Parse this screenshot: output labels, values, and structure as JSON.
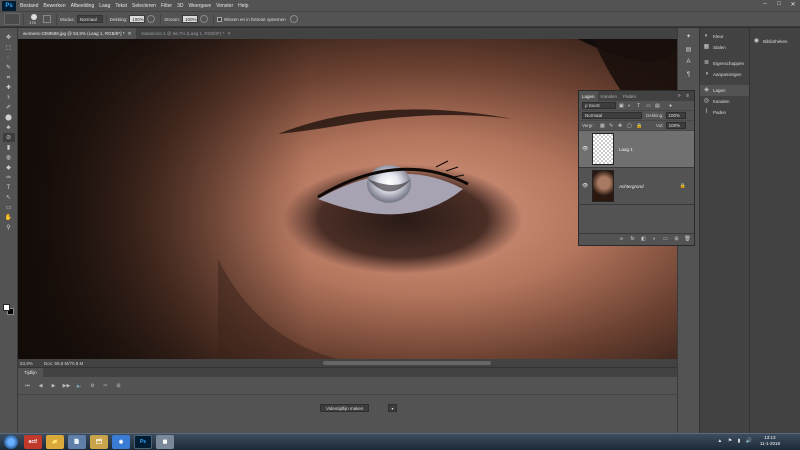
{
  "app": {
    "logo": "Ps"
  },
  "menu": [
    "Bestand",
    "Bewerken",
    "Afbeelding",
    "Laag",
    "Tekst",
    "Selecteren",
    "Filter",
    "3D",
    "Weergave",
    "Venster",
    "Help"
  ],
  "window_controls": [
    "–",
    "□",
    "✕"
  ],
  "options_bar": {
    "brush_size": "175",
    "mode_label": "Modus:",
    "mode_value": "Normaal",
    "opacity_label": "Dekking:",
    "opacity_value": "100%",
    "flow_label": "Stroom:",
    "flow_value": "100%",
    "erase_history_label": "Wissen en in historie opnemen"
  },
  "tabs": [
    {
      "label": "womens-2359588.jpg @ 53,9% (Laag 1, RGB/8*) *",
      "active": true
    },
    {
      "label": "Naamloos-1 @ 66,7% (Laag 1, RGB/8*) *",
      "active": false
    }
  ],
  "tools": [
    "✥",
    "⬚",
    "◌",
    "✎",
    "⌗",
    "✚",
    "⚕",
    "✐",
    "⬤",
    "♣",
    "⊘",
    "▮",
    "◍",
    "◆",
    "✑",
    "T",
    "↖",
    "▭",
    "✋",
    "⚲"
  ],
  "status": {
    "zoom": "53,9%",
    "doc": "Doc: 69,8 M/70,8 M"
  },
  "timeline": {
    "tab": "Tijdlijn",
    "controls": [
      "⏮",
      "◀",
      "▶",
      "▶▶",
      "🔈",
      "⚙",
      "✂",
      "⊞"
    ],
    "create_button": "Videotijdlijn maken",
    "dropdown": "▾"
  },
  "dock1": {
    "items": [
      {
        "label": "Kleur",
        "icon": "◐"
      },
      {
        "label": "Stalen",
        "icon": "▦"
      },
      {
        "label": "Eigenschappen",
        "icon": "≣"
      },
      {
        "label": "Aanpassingen",
        "icon": "◑"
      },
      {
        "label": "Lagen",
        "icon": "◈",
        "active": true
      },
      {
        "label": "Kanalen",
        "icon": "◎"
      },
      {
        "label": "Paden",
        "icon": "⌇"
      }
    ]
  },
  "dock2": {
    "items": [
      {
        "label": "Bibliotheken",
        "icon": "◉"
      }
    ]
  },
  "iconcol": [
    "✦",
    "▤",
    "A",
    "¶"
  ],
  "layers_panel": {
    "tabs": [
      "Lagen",
      "Kanalen",
      "Paden"
    ],
    "header_buttons": "» ≡",
    "filter_label": "ρ Soort",
    "blend_mode": "Normaal",
    "opacity_label": "Dekking:",
    "opacity_value": "100%",
    "lock_label": "Vergr.:",
    "fill_label": "Vul:",
    "fill_value": "100%",
    "layers": [
      {
        "name": "Laag 1",
        "active": true
      },
      {
        "name": "Achtergrond",
        "italic": true,
        "locked": true
      }
    ],
    "footer_icons": [
      "∞",
      "fx",
      "◧",
      "◐",
      "▭",
      "⊞",
      "🗑"
    ]
  },
  "taskbar": {
    "apps": [
      "act!",
      "📁",
      "📄",
      "🗂",
      "◉",
      "Ps",
      "▦"
    ],
    "time": "13:13",
    "date": "11-1-2018",
    "tray": "▲ ⚑ ▮ 🔊"
  }
}
